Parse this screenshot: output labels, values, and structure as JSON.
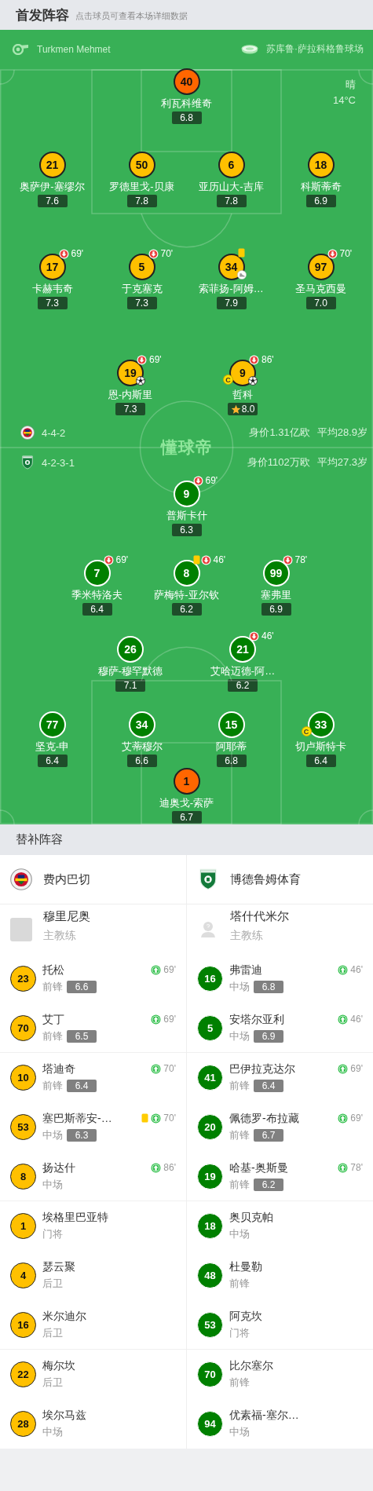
{
  "header": {
    "title": "首发阵容",
    "hint": "点击球员可查看本场详细数据"
  },
  "match_info": {
    "referee": "Turkmen Mehmet",
    "stadium": "苏库鲁·萨拉科格鲁球场",
    "weather": "晴",
    "temperature": "14°C"
  },
  "pitch_logo": "懂球帝",
  "teams": [
    {
      "name": "费内巴切",
      "formation": "4-4-2",
      "market_value": "身价1.31亿欧",
      "average_age": "平均28.9岁",
      "lineup": [
        [
          {
            "number": "40",
            "name": "利瓦科维奇",
            "rating": "6.8",
            "color": "#ff6600"
          }
        ],
        [
          {
            "number": "21",
            "name": "奥萨伊-塞缪尔",
            "rating": "7.6",
            "color": "#ffc000"
          },
          {
            "number": "50",
            "name": "罗德里戈-贝康",
            "rating": "7.8",
            "color": "#ffc000"
          },
          {
            "number": "6",
            "name": "亚历山大-吉库",
            "rating": "7.8",
            "color": "#ffc000"
          },
          {
            "number": "18",
            "name": "科斯蒂奇",
            "rating": "6.9",
            "color": "#ffc000"
          }
        ],
        [
          {
            "number": "17",
            "name": "卡赫韦奇",
            "rating": "7.3",
            "color": "#ffc000",
            "events": [
              {
                "kind": "sub_out",
                "minute": "69'"
              }
            ]
          },
          {
            "number": "5",
            "name": "于克塞克",
            "rating": "7.3",
            "color": "#ffc000",
            "events": [
              {
                "kind": "sub_out",
                "minute": "70'"
              }
            ]
          },
          {
            "number": "34",
            "name": "索菲扬-阿姆…",
            "rating": "7.9",
            "color": "#ffc000",
            "events": [
              {
                "kind": "yellow_card"
              },
              {
                "kind": "assist"
              }
            ]
          },
          {
            "number": "97",
            "name": "圣马克西曼",
            "rating": "7.0",
            "color": "#ffc000",
            "events": [
              {
                "kind": "sub_out",
                "minute": "70'"
              }
            ]
          }
        ],
        [
          {
            "number": "19",
            "name": "恩-内斯里",
            "rating": "7.3",
            "color": "#ffc000",
            "events": [
              {
                "kind": "sub_out",
                "minute": "69'"
              },
              {
                "kind": "goal"
              }
            ]
          },
          {
            "number": "9",
            "name": "哲科",
            "rating": "8.0",
            "color": "#ffc000",
            "events": [
              {
                "kind": "sub_out",
                "minute": "86'"
              },
              {
                "kind": "goal"
              },
              {
                "kind": "captain",
                "label": "C"
              },
              {
                "kind": "best_player"
              }
            ]
          }
        ]
      ],
      "coach": {
        "name": "穆里尼奥",
        "role": "主教练",
        "photo": true
      },
      "substitutes": [
        {
          "number": "23",
          "name": "托松",
          "position": "前锋",
          "rating": "6.6",
          "events": [
            {
              "kind": "sub_in",
              "minute": "69'"
            }
          ]
        },
        {
          "number": "70",
          "name": "艾丁",
          "position": "前锋",
          "rating": "6.5",
          "events": [
            {
              "kind": "sub_in",
              "minute": "69'"
            }
          ]
        },
        {
          "number": "10",
          "name": "塔迪奇",
          "position": "前锋",
          "rating": "6.4",
          "events": [
            {
              "kind": "sub_in",
              "minute": "70'"
            }
          ]
        },
        {
          "number": "53",
          "name": "塞巴斯蒂安-…",
          "position": "中场",
          "rating": "6.3",
          "events": [
            {
              "kind": "yellow_card"
            },
            {
              "kind": "sub_in",
              "minute": "70'"
            }
          ]
        },
        {
          "number": "8",
          "name": "扬达什",
          "position": "中场",
          "events": [
            {
              "kind": "sub_in",
              "minute": "86'"
            }
          ]
        },
        {
          "number": "1",
          "name": "埃格里巴亚特",
          "position": "门将"
        },
        {
          "number": "4",
          "name": "瑟云聚",
          "position": "后卫"
        },
        {
          "number": "16",
          "name": "米尔迪尔",
          "position": "后卫"
        },
        {
          "number": "22",
          "name": "梅尔坎",
          "position": "后卫"
        },
        {
          "number": "28",
          "name": "埃尔马兹",
          "position": "中场"
        }
      ]
    },
    {
      "name": "博德鲁姆体育",
      "formation": "4-2-3-1",
      "market_value": "身价1102万欧",
      "average_age": "平均27.3岁",
      "lineup": [
        [
          {
            "number": "9",
            "name": "普斯卡什",
            "rating": "6.3",
            "color": "#008000",
            "events": [
              {
                "kind": "sub_out",
                "minute": "69'"
              }
            ]
          }
        ],
        [
          {
            "number": "7",
            "name": "季米特洛夫",
            "rating": "6.4",
            "color": "#008000",
            "events": [
              {
                "kind": "sub_out",
                "minute": "69'"
              }
            ]
          },
          {
            "number": "8",
            "name": "萨梅特-亚尔钦",
            "rating": "6.2",
            "color": "#008000",
            "events": [
              {
                "kind": "yellow_card"
              },
              {
                "kind": "sub_out",
                "minute": "46'"
              }
            ]
          },
          {
            "number": "99",
            "name": "塞弗里",
            "rating": "6.9",
            "color": "#008000",
            "events": [
              {
                "kind": "sub_out",
                "minute": "78'"
              }
            ]
          }
        ],
        [
          {
            "number": "26",
            "name": "穆萨-穆罕默德",
            "rating": "7.1",
            "color": "#008000"
          },
          {
            "number": "21",
            "name": "艾哈迈德-阿…",
            "rating": "6.2",
            "color": "#008000",
            "events": [
              {
                "kind": "sub_out",
                "minute": "46'"
              }
            ]
          }
        ],
        [
          {
            "number": "77",
            "name": "坚克-申",
            "rating": "6.4",
            "color": "#008000"
          },
          {
            "number": "34",
            "name": "艾蒂穆尔",
            "rating": "6.6",
            "color": "#008000"
          },
          {
            "number": "15",
            "name": "阿耶蒂",
            "rating": "6.8",
            "color": "#008000"
          },
          {
            "number": "33",
            "name": "切卢斯特卡",
            "rating": "6.4",
            "color": "#008000",
            "events": [
              {
                "kind": "captain",
                "label": "C"
              }
            ]
          }
        ],
        [
          {
            "number": "1",
            "name": "迪奥戈-索萨",
            "rating": "6.7",
            "color": "#ff6600"
          }
        ]
      ],
      "coach": {
        "name": "塔什代米尔",
        "role": "主教练",
        "photo": false
      },
      "substitutes": [
        {
          "number": "16",
          "name": "弗雷迪",
          "position": "中场",
          "rating": "6.8",
          "events": [
            {
              "kind": "sub_in",
              "minute": "46'"
            }
          ]
        },
        {
          "number": "5",
          "name": "安塔尔亚利",
          "position": "中场",
          "rating": "6.9",
          "events": [
            {
              "kind": "sub_in",
              "minute": "46'"
            }
          ]
        },
        {
          "number": "41",
          "name": "巴伊拉克达尔",
          "position": "前锋",
          "rating": "6.4",
          "events": [
            {
              "kind": "sub_in",
              "minute": "69'"
            }
          ]
        },
        {
          "number": "20",
          "name": "佩德罗-布拉藏",
          "position": "前锋",
          "rating": "6.7",
          "events": [
            {
              "kind": "sub_in",
              "minute": "69'"
            }
          ]
        },
        {
          "number": "19",
          "name": "哈基-奥斯曼",
          "position": "前锋",
          "rating": "6.2",
          "events": [
            {
              "kind": "sub_in",
              "minute": "78'"
            }
          ]
        },
        {
          "number": "18",
          "name": "奥贝克帕",
          "position": "中场"
        },
        {
          "number": "48",
          "name": "杜曼勒",
          "position": "前锋"
        },
        {
          "number": "53",
          "name": "阿克坎",
          "position": "门将"
        },
        {
          "number": "70",
          "name": "比尔塞尔",
          "position": "前锋"
        },
        {
          "number": "94",
          "name": "优素福-塞尔…",
          "position": "中场"
        }
      ]
    }
  ],
  "substitutes_header": {
    "title": "替补阵容"
  }
}
